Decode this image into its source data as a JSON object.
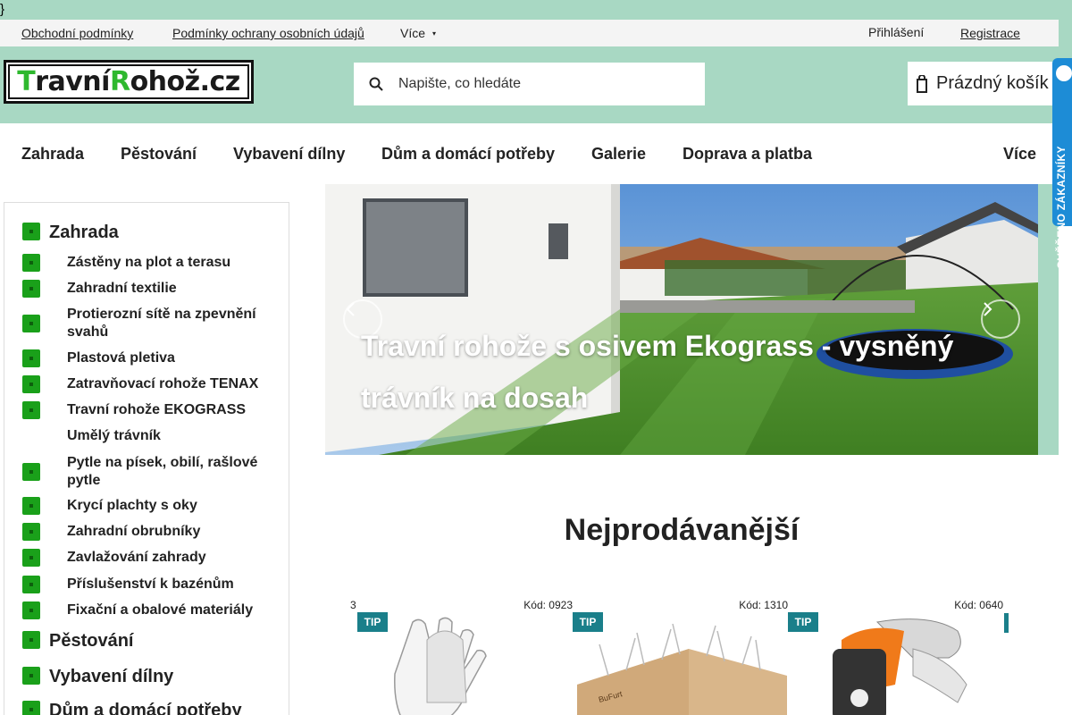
{
  "stray_text": "}",
  "topbar": {
    "links": [
      "Obchodní podmínky",
      "Podmínky ochrany osobních údajů"
    ],
    "more": "Více",
    "login": "Přihlášení",
    "register": "Registrace"
  },
  "header": {
    "logo": "TravníRohož.cz",
    "search_placeholder": "Napište, co hledáte",
    "cart_label": "Prázdný košík",
    "verified_badge": "OVĚŘENO ZÁKAZNÍKY"
  },
  "nav": {
    "items": [
      "Zahrada",
      "Pěstování",
      "Vybavení dílny",
      "Dům a domácí potřeby",
      "Galerie",
      "Doprava a platba"
    ],
    "more": "Více"
  },
  "sidebar": {
    "top_category": "Zahrada",
    "subcategories": [
      "Zástěny na plot a terasu",
      "Zahradní textilie",
      "Protierozní sítě na zpevnění svahů",
      "Plastová pletiva",
      "Zatravňovací rohože TENAX",
      "Travní rohože EKOGRASS",
      "Umělý trávník",
      "Pytle na písek, obilí, rašlové pytle",
      "Krycí plachty s oky",
      "Zahradní obrubníky",
      "Zavlažování zahrady",
      "Příslušenství k bazénům",
      "Fixační a obalové materiály"
    ],
    "more_categories": [
      "Pěstování",
      "Vybavení dílny",
      "Dům a domácí potřeby"
    ]
  },
  "hero": {
    "caption": "Travní rohože s osivem Ekograss - vysněný trávník na dosah"
  },
  "bestsellers": {
    "heading": "Nejprodávanější",
    "partial_code": "3",
    "products": [
      {
        "code": "Kód: 0923",
        "badge": "TIP",
        "image": "gloves"
      },
      {
        "code": "Kód: 1310",
        "badge": "TIP",
        "image": "bird-spikes-box"
      },
      {
        "code": "Kód: 0640",
        "badge": "TIP",
        "image": "sprinkler"
      }
    ]
  },
  "colors": {
    "header_bg": "#a8d8c3",
    "bullet_green": "#1aa01a",
    "tip_badge": "#1a7f8a",
    "verified_blue": "#1d8cd6"
  }
}
